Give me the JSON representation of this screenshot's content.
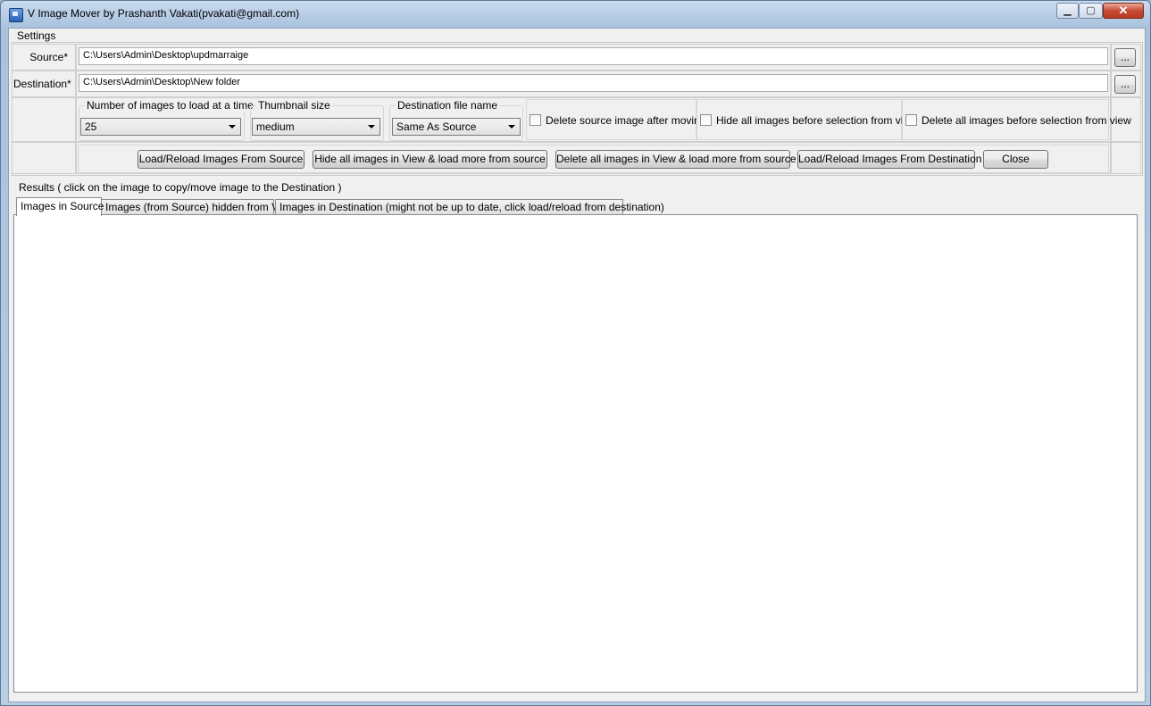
{
  "window": {
    "title": "V Image Mover by Prashanth Vakati(pvakati@gmail.com)",
    "min_glyph": "▁",
    "max_glyph": "▢",
    "close_glyph": "✕"
  },
  "settings": {
    "group_label": "Settings",
    "source_label": "Source*",
    "source_value": "C:\\Users\\Admin\\Desktop\\updmarraige",
    "destination_label": "Destination*",
    "destination_value": "C:\\Users\\Admin\\Desktop\\New folder",
    "browse_label": "...",
    "num_images": {
      "caption": "Number of images to load at a time",
      "value": "25"
    },
    "thumb_size": {
      "caption": "Thumbnail size",
      "value": "medium"
    },
    "dest_name": {
      "caption": "Destination file name",
      "value": "Same As Source"
    },
    "chk_delete_source": "Delete source image after moving",
    "chk_hide_before": "Hide all images before selection from view",
    "chk_delete_before": "Delete all images before selection from view"
  },
  "actions": {
    "load_source": "Load/Reload Images From Source",
    "hide_all": "Hide all images in View  & load more from source",
    "delete_all": "Delete all images in View  & load more from source",
    "load_dest": "Load/Reload Images From Destination",
    "close": "Close"
  },
  "results": {
    "group_label": "Results ( click on the image to copy/move image to the Destination )",
    "tabs": [
      {
        "label": "Images in Source"
      },
      {
        "label": "Images (from Source) hidden from View"
      },
      {
        "label": "Images in Destination (might not be up to date, click load/reload from destination)"
      }
    ]
  }
}
